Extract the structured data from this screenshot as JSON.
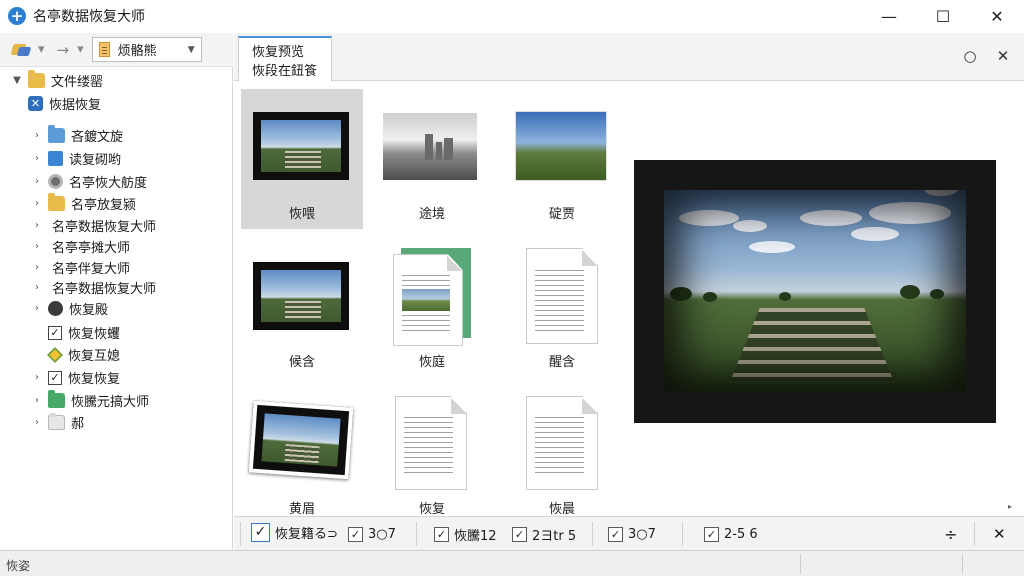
{
  "app": {
    "title": "名亭数据恢复大师",
    "icon": "plus-circle-icon"
  },
  "window_controls": {
    "minimize": "—",
    "maximize": "☐",
    "close": "✕"
  },
  "toolbar": {
    "combo_value": "烦骼熊"
  },
  "tree": [
    {
      "label": "文件缕罂",
      "icon": "folder-icon",
      "expander": "▼"
    },
    {
      "label": "恢据恢复",
      "icon": "recovery-icon",
      "expander": ""
    },
    {
      "label": "吝鍍文旋",
      "icon": "folder-blue-icon",
      "expander": "›"
    },
    {
      "label": "读复砌哟",
      "icon": "tile-icon",
      "expander": "›"
    },
    {
      "label": "名亭恢大舫度",
      "icon": "disk-icon",
      "expander": "›"
    },
    {
      "label": "名亭放复颍",
      "icon": "folder-icon",
      "expander": "›"
    },
    {
      "label": "名亭数据恢复大师",
      "icon": "",
      "expander": "›"
    },
    {
      "label": "名亭亭摊大师",
      "icon": "",
      "expander": "›"
    },
    {
      "label": "名亭伴复大师",
      "icon": "",
      "expander": "›"
    },
    {
      "label": "名亭数据恢复大师",
      "icon": "",
      "expander": "›"
    },
    {
      "label": "恢复殿",
      "icon": "dark-disk-icon",
      "expander": "›"
    },
    {
      "label": "恢复恢蠼",
      "icon": "checkbox-icon",
      "expander": ""
    },
    {
      "label": "恢复互媳",
      "icon": "diamond-icon",
      "expander": ""
    },
    {
      "label": "恢复恢复",
      "icon": "checkbox-icon",
      "expander": "›"
    },
    {
      "label": "恢騰元搞大师",
      "icon": "folder-green-icon",
      "expander": "›"
    },
    {
      "label": "郝",
      "icon": "folder-gray-icon",
      "expander": "›"
    }
  ],
  "tab": {
    "line1": "恢复预览",
    "line2": "恢段在鈕篒"
  },
  "header_buttons": {
    "circle": "○",
    "close": "✕"
  },
  "thumbnails": [
    {
      "label": "恢喂"
    },
    {
      "label": "途境"
    },
    {
      "label": "碇贾"
    },
    {
      "label": "候含"
    },
    {
      "label": "恢庭"
    },
    {
      "label": "醒含"
    },
    {
      "label": "黄眉"
    },
    {
      "label": "恢复"
    },
    {
      "label": "恢晨"
    }
  ],
  "filters": [
    {
      "label": "恢复籍る⊃",
      "checked": true
    },
    {
      "label": "3○7",
      "checked": true
    },
    {
      "label": "恢騰12",
      "checked": true
    },
    {
      "label": "2ヨtr 5",
      "checked": true
    },
    {
      "label": "3○7",
      "checked": true
    },
    {
      "label": "2-5 6",
      "checked": true
    }
  ],
  "bottom_buttons": {
    "split": "÷",
    "close": "✕"
  },
  "status": {
    "text": "恢姿"
  }
}
